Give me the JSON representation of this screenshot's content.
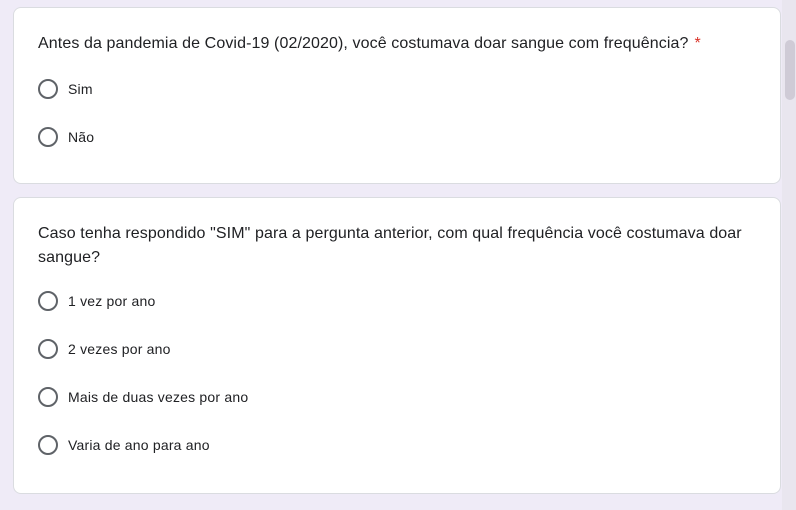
{
  "questions": [
    {
      "title": "Antes da pandemia de Covid-19 (02/2020), você costumava doar sangue com frequência?",
      "required_mark": "*",
      "options": [
        "Sim",
        "Não"
      ]
    },
    {
      "title": "Caso tenha respondido \"SIM\" para a pergunta anterior, com qual frequência você costumava doar sangue?",
      "options": [
        "1 vez por ano",
        "2 vezes por ano",
        "Mais de duas vezes por ano",
        "Varia de ano para ano"
      ]
    }
  ],
  "colors": {
    "background": "#efebf7",
    "card": "#ffffff",
    "required": "#d93025",
    "radio_border": "#5f6368"
  }
}
